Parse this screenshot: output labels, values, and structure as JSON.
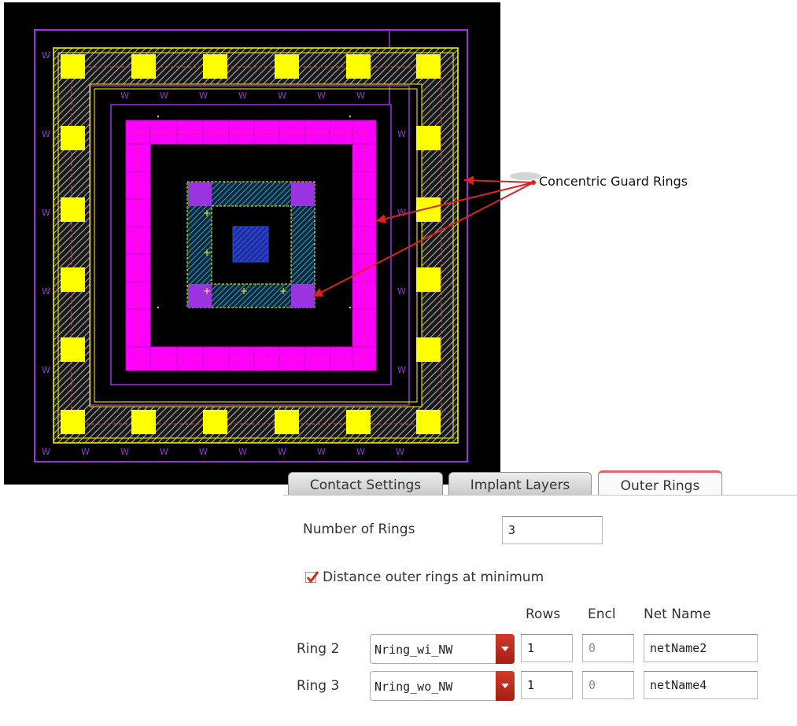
{
  "annotation": {
    "text": "Concentric Guard Rings"
  },
  "tabs": [
    {
      "label": "Contact Settings",
      "active": false
    },
    {
      "label": "Implant Layers",
      "active": false
    },
    {
      "label": "Outer Rings",
      "active": true
    }
  ],
  "form": {
    "number_of_rings_label": "Number of Rings",
    "number_of_rings_value": "3",
    "distance_checkbox_label": "Distance outer rings at minimum",
    "distance_checkbox_checked": true,
    "columns": {
      "rows": "Rows",
      "encl": "Encl",
      "net_name": "Net Name"
    },
    "rings": [
      {
        "label": "Ring 2",
        "type": "Nring_wi_NW",
        "rows": "1",
        "encl": "0",
        "net_name": "netName2"
      },
      {
        "label": "Ring 3",
        "type": "Nring_wo_NW",
        "rows": "1",
        "encl": "0",
        "net_name": "netName4"
      }
    ]
  },
  "colors": {
    "metal_pink": "#ff00ff",
    "contact_yellow": "#ffff00",
    "nwell_purple": "#9a33e0",
    "diffusion_blue": "#2f7fb0",
    "arrow_red": "#e02020",
    "combo_red": "#c0281a"
  }
}
